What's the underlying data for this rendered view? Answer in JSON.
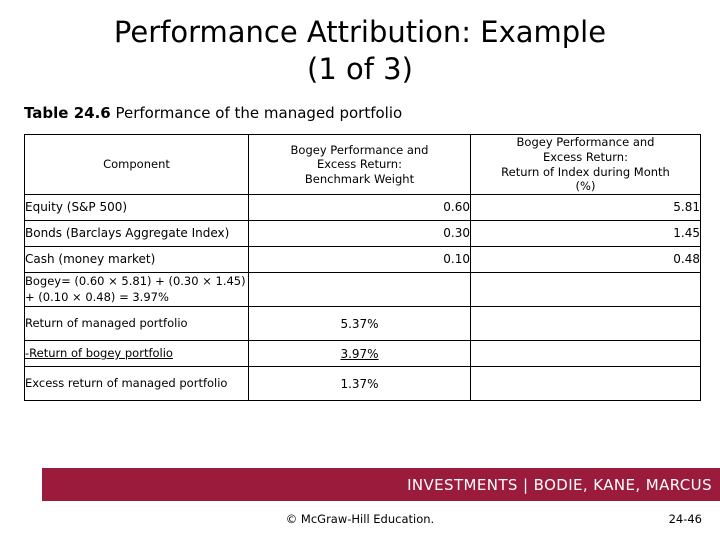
{
  "slide": {
    "title_line1": "Performance Attribution: Example",
    "title_line2": "(1 of 3)"
  },
  "caption": {
    "strong": "Table 24.6",
    "rest": " Performance of the managed portfolio"
  },
  "table": {
    "headers": {
      "component": "Component",
      "benchmark_weight": "Bogey Performance and\nExcess Return:\nBenchmark Weight",
      "benchmark_weight_l1": "Bogey Performance and",
      "benchmark_weight_l2": "Excess Return:",
      "benchmark_weight_l3": "Benchmark Weight",
      "index_return_l1": "Bogey Performance and",
      "index_return_l2": "Excess Return:",
      "index_return_l3": "Return of Index during Month",
      "index_return_l4": "(%)"
    },
    "rows": [
      {
        "label": "Equity (S&P 500)",
        "weight": "0.60",
        "index_return": "5.81"
      },
      {
        "label": "Bonds (Barclays Aggregate Index)",
        "weight": "0.30",
        "index_return": "1.45"
      },
      {
        "label": "Cash (money market)",
        "weight": "0.10",
        "index_return": "0.48"
      }
    ],
    "formula_row": {
      "text": "Bogey= (0.60 × 5.81) + (0.30 × 1.45) + (0.10 × 0.48) = 3.97%",
      "weight": "",
      "index_return": ""
    },
    "summary_rows": [
      {
        "label": "Return of managed portfolio",
        "value": "5.37%",
        "underline": false
      },
      {
        "label": "-Return of bogey portfolio",
        "value": "3.97%",
        "underline": true
      },
      {
        "label": "Excess return of managed portfolio",
        "value": "1.37%",
        "underline": false
      }
    ]
  },
  "footer": {
    "banner_text": "INVESTMENTS | BODIE, KANE, MARCUS",
    "banner_color": "#9B1B3C",
    "copyright": "© McGraw-Hill Education.",
    "page_number": "24-46"
  }
}
